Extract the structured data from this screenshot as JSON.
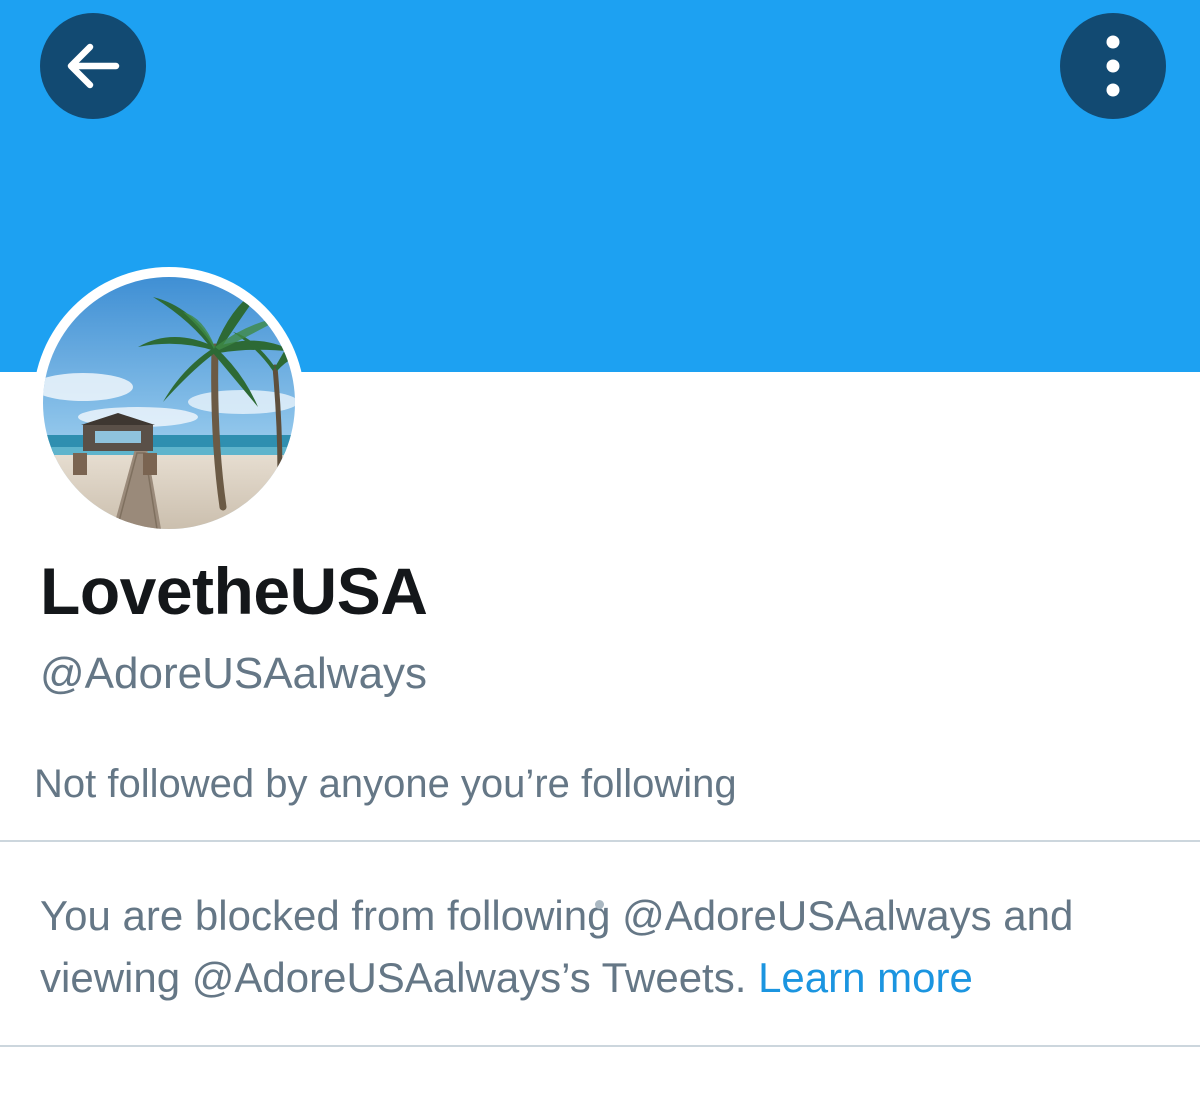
{
  "header": {
    "back_icon": "arrow-left-icon",
    "more_icon": "more-vertical-icon",
    "banner_color": "#1da1f2"
  },
  "profile": {
    "display_name": "LovetheUSA",
    "handle": "@AdoreUSAalways",
    "avatar_icon": "beach-palm-avatar",
    "follow_context": "Not followed by anyone you’re following"
  },
  "blocked_notice": {
    "text": "You are blocked from following @AdoreUSAalways and viewing @AdoreUSAalways’s Tweets.",
    "link_label": "Learn more",
    "link_color": "#1b95e0"
  }
}
